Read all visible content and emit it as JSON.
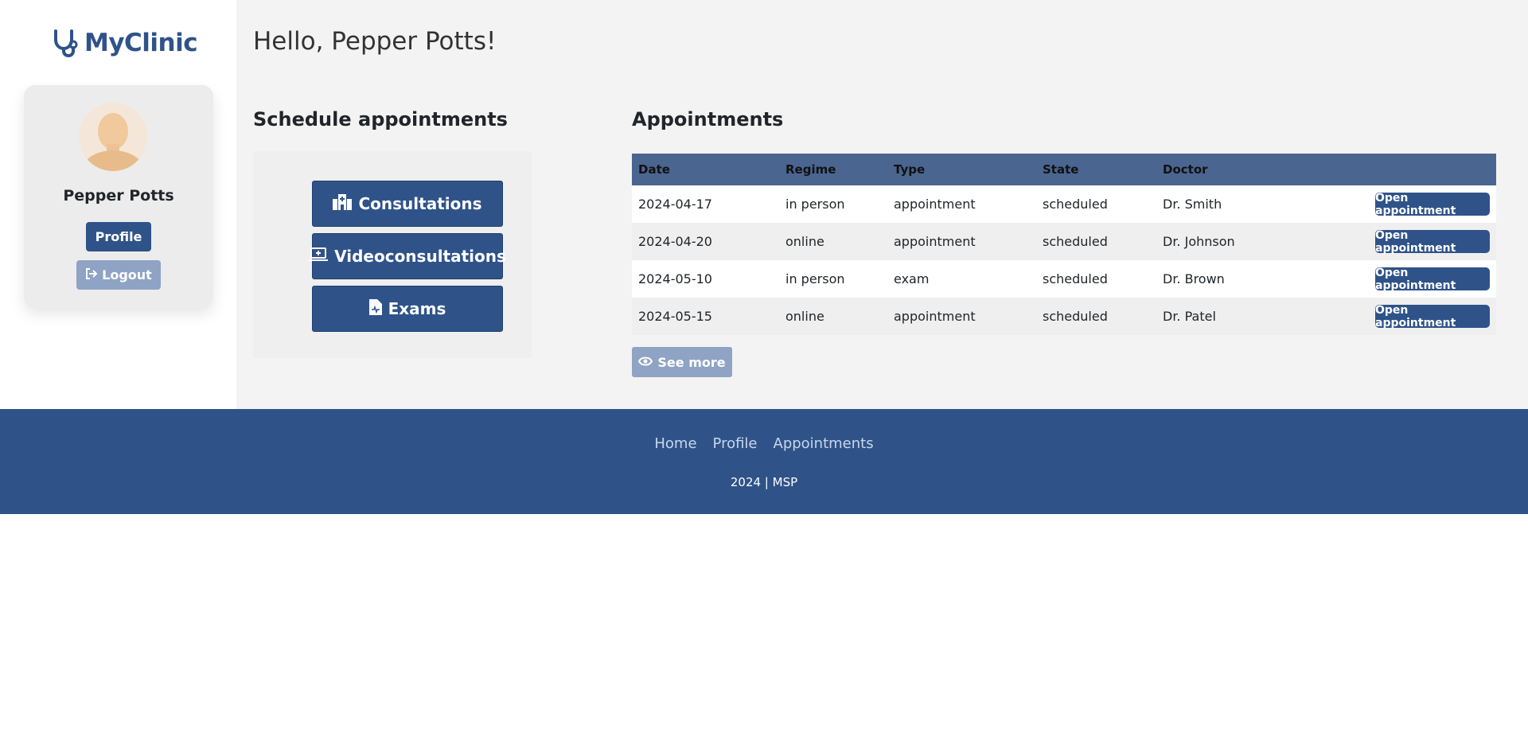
{
  "brand": {
    "name": "MyClinic",
    "icon": "stethoscope-icon"
  },
  "greeting": "Hello, Pepper Potts!",
  "profile_card": {
    "name": "Pepper Potts",
    "profile_label": "Profile",
    "logout_label": "Logout",
    "logout_icon": "sign-out-icon"
  },
  "schedule": {
    "title": "Schedule appointments",
    "buttons": [
      {
        "label": "Consultations",
        "icon": "hospital-icon"
      },
      {
        "label": "Videoconsultations",
        "icon": "laptop-medical-icon"
      },
      {
        "label": "Exams",
        "icon": "file-medical-icon"
      }
    ]
  },
  "appointments": {
    "title": "Appointments",
    "columns": [
      "Date",
      "Regime",
      "Type",
      "State",
      "Doctor"
    ],
    "rows": [
      {
        "date": "2024-04-17",
        "regime": "in person",
        "type": "appointment",
        "state": "scheduled",
        "doctor": "Dr. Smith",
        "action": "Open appointment"
      },
      {
        "date": "2024-04-20",
        "regime": "online",
        "type": "appointment",
        "state": "scheduled",
        "doctor": "Dr. Johnson",
        "action": "Open appointment"
      },
      {
        "date": "2024-05-10",
        "regime": "in person",
        "type": "exam",
        "state": "scheduled",
        "doctor": "Dr. Brown",
        "action": "Open appointment"
      },
      {
        "date": "2024-05-15",
        "regime": "online",
        "type": "appointment",
        "state": "scheduled",
        "doctor": "Dr. Patel",
        "action": "Open appointment"
      }
    ],
    "see_more_label": "See more",
    "see_more_icon": "eye-icon"
  },
  "footer": {
    "links": [
      "Home",
      "Profile",
      "Appointments"
    ],
    "copyright": "2024 | MSP"
  },
  "colors": {
    "primary": "#2f5389",
    "muted_button": "#8fa3c4",
    "table_header": "#4a6590",
    "main_bg": "#f3f3f3"
  }
}
